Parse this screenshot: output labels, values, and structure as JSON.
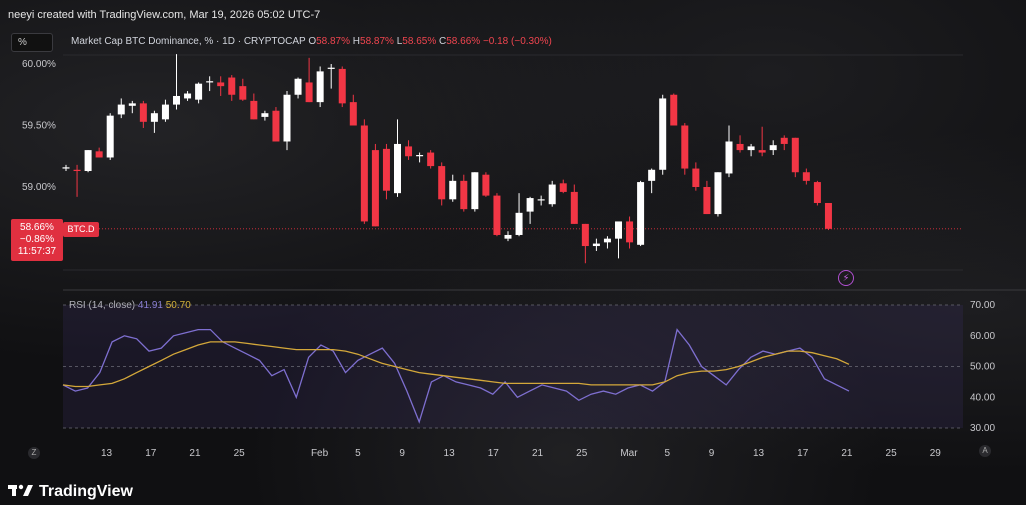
{
  "credit": "neeyi created with TradingView.com, Mar 19, 2026 05:02 UTC-7",
  "symbol_box": "%",
  "legend": {
    "title": "Market Cap BTC Dominance, % · 1D · CRYPTOCAP",
    "o_label": "O",
    "o": "58.87%",
    "h_label": "H",
    "h": "58.87%",
    "l_label": "L",
    "l": "58.65%",
    "c_label": "C",
    "c": "58.66%",
    "change": "−0.18 (−0.30%)"
  },
  "price_label": {
    "price": "58.66%",
    "change": "−0.86%",
    "countdown": "11:57:37"
  },
  "symbol_tag": "BTC.D",
  "rsi_legend": {
    "label": "RSI (14, close)",
    "rsi": "41.91",
    "ma": "50.70"
  },
  "footer_logo": "TradingView",
  "footer_left_button": "Z",
  "footer_right_button": "A",
  "colors": {
    "up": "#ffffff",
    "down": "#f23645",
    "rsi": "#7e6fd0",
    "rsi_ma": "#d4a83a",
    "background": "#101012"
  },
  "chart_data": [
    {
      "type": "candlestick",
      "title": "Market Cap BTC Dominance, % · 1D · CRYPTOCAP",
      "y_ticks": [
        "60.00%",
        "59.50%",
        "59.00%"
      ],
      "ylim": [
        58.4,
        60.07
      ],
      "x_ticks": [
        {
          "label": "13",
          "index": 0
        },
        {
          "label": "17",
          "index": 4
        },
        {
          "label": "21",
          "index": 8
        },
        {
          "label": "25",
          "index": 12
        },
        {
          "label": "Feb",
          "index": 19
        },
        {
          "label": "5",
          "index": 23
        },
        {
          "label": "9",
          "index": 27
        },
        {
          "label": "13",
          "index": 31
        },
        {
          "label": "17",
          "index": 35
        },
        {
          "label": "21",
          "index": 39
        },
        {
          "label": "25",
          "index": 43
        },
        {
          "label": "Mar",
          "index": 47
        },
        {
          "label": "5",
          "index": 51
        },
        {
          "label": "9",
          "index": 55
        },
        {
          "label": "13",
          "index": 59
        },
        {
          "label": "17",
          "index": 63
        },
        {
          "label": "21",
          "index": 67
        },
        {
          "label": "25",
          "index": 71
        },
        {
          "label": "29",
          "index": 75
        }
      ],
      "candles": [
        {
          "o": 59.15,
          "h": 59.18,
          "l": 59.13,
          "c": 59.16
        },
        {
          "o": 59.14,
          "h": 59.18,
          "l": 58.92,
          "c": 59.13
        },
        {
          "o": 59.13,
          "h": 59.3,
          "l": 59.12,
          "c": 59.3
        },
        {
          "o": 59.29,
          "h": 59.32,
          "l": 59.25,
          "c": 59.24
        },
        {
          "o": 59.24,
          "h": 59.6,
          "l": 59.22,
          "c": 59.58
        },
        {
          "o": 59.59,
          "h": 59.72,
          "l": 59.56,
          "c": 59.67
        },
        {
          "o": 59.66,
          "h": 59.7,
          "l": 59.6,
          "c": 59.68
        },
        {
          "o": 59.68,
          "h": 59.7,
          "l": 59.48,
          "c": 59.53
        },
        {
          "o": 59.53,
          "h": 59.62,
          "l": 59.44,
          "c": 59.6
        },
        {
          "o": 59.55,
          "h": 59.71,
          "l": 59.53,
          "c": 59.67
        },
        {
          "o": 59.67,
          "h": 60.08,
          "l": 59.63,
          "c": 59.74
        },
        {
          "o": 59.72,
          "h": 59.78,
          "l": 59.7,
          "c": 59.76
        },
        {
          "o": 59.71,
          "h": 59.85,
          "l": 59.68,
          "c": 59.84
        },
        {
          "o": 59.85,
          "h": 59.9,
          "l": 59.78,
          "c": 59.86
        },
        {
          "o": 59.85,
          "h": 59.9,
          "l": 59.74,
          "c": 59.82
        },
        {
          "o": 59.89,
          "h": 59.91,
          "l": 59.7,
          "c": 59.75
        },
        {
          "o": 59.82,
          "h": 59.88,
          "l": 59.7,
          "c": 59.71
        },
        {
          "o": 59.7,
          "h": 59.76,
          "l": 59.57,
          "c": 59.55
        },
        {
          "o": 59.57,
          "h": 59.62,
          "l": 59.54,
          "c": 59.6
        },
        {
          "o": 59.62,
          "h": 59.65,
          "l": 59.37,
          "c": 59.37
        },
        {
          "o": 59.37,
          "h": 59.78,
          "l": 59.3,
          "c": 59.75
        },
        {
          "o": 59.75,
          "h": 59.89,
          "l": 59.72,
          "c": 59.88
        },
        {
          "o": 59.85,
          "h": 60.05,
          "l": 59.7,
          "c": 59.69
        },
        {
          "o": 59.69,
          "h": 59.98,
          "l": 59.65,
          "c": 59.94
        },
        {
          "o": 59.96,
          "h": 60.0,
          "l": 59.8,
          "c": 59.97
        },
        {
          "o": 59.96,
          "h": 59.98,
          "l": 59.65,
          "c": 59.68
        },
        {
          "o": 59.69,
          "h": 59.75,
          "l": 59.5,
          "c": 59.5
        },
        {
          "o": 59.5,
          "h": 59.55,
          "l": 58.7,
          "c": 58.72
        },
        {
          "o": 59.3,
          "h": 59.35,
          "l": 58.68,
          "c": 58.68
        },
        {
          "o": 59.31,
          "h": 59.35,
          "l": 58.9,
          "c": 58.97
        },
        {
          "o": 58.95,
          "h": 59.55,
          "l": 58.92,
          "c": 59.35
        },
        {
          "o": 59.33,
          "h": 59.38,
          "l": 59.22,
          "c": 59.25
        },
        {
          "o": 59.25,
          "h": 59.28,
          "l": 59.2,
          "c": 59.26
        },
        {
          "o": 59.28,
          "h": 59.3,
          "l": 59.15,
          "c": 59.17
        },
        {
          "o": 59.17,
          "h": 59.2,
          "l": 58.85,
          "c": 58.9
        },
        {
          "o": 58.9,
          "h": 59.1,
          "l": 58.88,
          "c": 59.05
        },
        {
          "o": 59.05,
          "h": 59.1,
          "l": 58.8,
          "c": 58.82
        },
        {
          "o": 58.82,
          "h": 59.12,
          "l": 58.8,
          "c": 59.12
        },
        {
          "o": 59.1,
          "h": 59.12,
          "l": 58.92,
          "c": 58.93
        },
        {
          "o": 58.93,
          "h": 58.95,
          "l": 58.6,
          "c": 58.61
        },
        {
          "o": 58.58,
          "h": 58.64,
          "l": 58.56,
          "c": 58.61
        },
        {
          "o": 58.61,
          "h": 58.95,
          "l": 58.6,
          "c": 58.79
        },
        {
          "o": 58.8,
          "h": 58.92,
          "l": 58.7,
          "c": 58.91
        },
        {
          "o": 58.9,
          "h": 58.93,
          "l": 58.85,
          "c": 58.9
        },
        {
          "o": 58.86,
          "h": 59.05,
          "l": 58.84,
          "c": 59.02
        },
        {
          "o": 59.03,
          "h": 59.06,
          "l": 58.95,
          "c": 58.96
        },
        {
          "o": 58.96,
          "h": 59.02,
          "l": 58.7,
          "c": 58.7
        },
        {
          "o": 58.7,
          "h": 58.45,
          "l": 58.38,
          "c": 58.52
        },
        {
          "o": 58.52,
          "h": 58.58,
          "l": 58.48,
          "c": 58.54
        },
        {
          "o": 58.55,
          "h": 58.6,
          "l": 58.5,
          "c": 58.58
        },
        {
          "o": 58.58,
          "h": 58.72,
          "l": 58.42,
          "c": 58.72
        },
        {
          "o": 58.72,
          "h": 58.76,
          "l": 58.5,
          "c": 58.55
        },
        {
          "o": 58.53,
          "h": 59.05,
          "l": 58.52,
          "c": 59.04
        },
        {
          "o": 59.05,
          "h": 59.15,
          "l": 58.95,
          "c": 59.14
        },
        {
          "o": 59.14,
          "h": 59.75,
          "l": 59.1,
          "c": 59.72
        },
        {
          "o": 59.75,
          "h": 59.76,
          "l": 59.5,
          "c": 59.5
        },
        {
          "o": 59.5,
          "h": 59.52,
          "l": 59.1,
          "c": 59.15
        },
        {
          "o": 59.15,
          "h": 59.2,
          "l": 58.97,
          "c": 59.0
        },
        {
          "o": 59.0,
          "h": 59.05,
          "l": 58.78,
          "c": 58.78
        },
        {
          "o": 58.78,
          "h": 59.12,
          "l": 58.76,
          "c": 59.12
        },
        {
          "o": 59.11,
          "h": 59.5,
          "l": 59.08,
          "c": 59.37
        },
        {
          "o": 59.35,
          "h": 59.42,
          "l": 59.28,
          "c": 59.3
        },
        {
          "o": 59.3,
          "h": 59.35,
          "l": 59.25,
          "c": 59.33
        },
        {
          "o": 59.3,
          "h": 59.49,
          "l": 59.25,
          "c": 59.28
        },
        {
          "o": 59.3,
          "h": 59.38,
          "l": 59.26,
          "c": 59.34
        },
        {
          "o": 59.4,
          "h": 59.42,
          "l": 59.3,
          "c": 59.35
        },
        {
          "o": 59.4,
          "h": 59.4,
          "l": 59.08,
          "c": 59.12
        },
        {
          "o": 59.12,
          "h": 59.15,
          "l": 59.02,
          "c": 59.05
        },
        {
          "o": 59.04,
          "h": 59.05,
          "l": 58.85,
          "c": 58.87
        },
        {
          "o": 58.87,
          "h": 58.87,
          "l": 58.65,
          "c": 58.66
        }
      ]
    },
    {
      "type": "line",
      "title": "RSI (14, close)",
      "y_ticks": [
        "70.00",
        "60.00",
        "50.00",
        "40.00",
        "30.00"
      ],
      "ylim": [
        30,
        70
      ],
      "series": [
        {
          "name": "RSI",
          "values": [
            44,
            42,
            43,
            48,
            58,
            60,
            59,
            55,
            56,
            60,
            61,
            62,
            62,
            58,
            56,
            54,
            52,
            47,
            49,
            40,
            53,
            57,
            55,
            48,
            52,
            54,
            56,
            51,
            42,
            32,
            45,
            47,
            45,
            44,
            43,
            41,
            45,
            40,
            42,
            44,
            43,
            42,
            39,
            41,
            42,
            41,
            43,
            44,
            42,
            45,
            62,
            57,
            50,
            47,
            44,
            49,
            53,
            55,
            54,
            55,
            56,
            53,
            46,
            44,
            42
          ]
        },
        {
          "name": "RSI MA",
          "values": [
            44,
            43.5,
            43.5,
            44,
            44.5,
            46,
            48,
            50,
            52,
            54,
            55.5,
            57,
            58,
            58,
            58,
            57.5,
            57,
            56.5,
            56,
            55.5,
            55.5,
            55.5,
            55.5,
            55,
            54,
            52.5,
            51,
            50,
            49,
            48,
            47.5,
            47,
            46.5,
            46,
            45.5,
            45,
            44.5,
            44.5,
            44.5,
            44.5,
            44.5,
            44.5,
            44.5,
            44,
            44,
            44,
            44,
            44,
            44,
            45,
            47,
            48,
            48.5,
            48.5,
            49,
            50,
            51.5,
            53,
            54,
            55,
            55,
            54.5,
            53.5,
            52.5,
            50.7
          ]
        }
      ],
      "rsi_x_ticks": [
        "70.00",
        "60.00",
        "50.00",
        "40.00",
        "30.00"
      ]
    }
  ]
}
